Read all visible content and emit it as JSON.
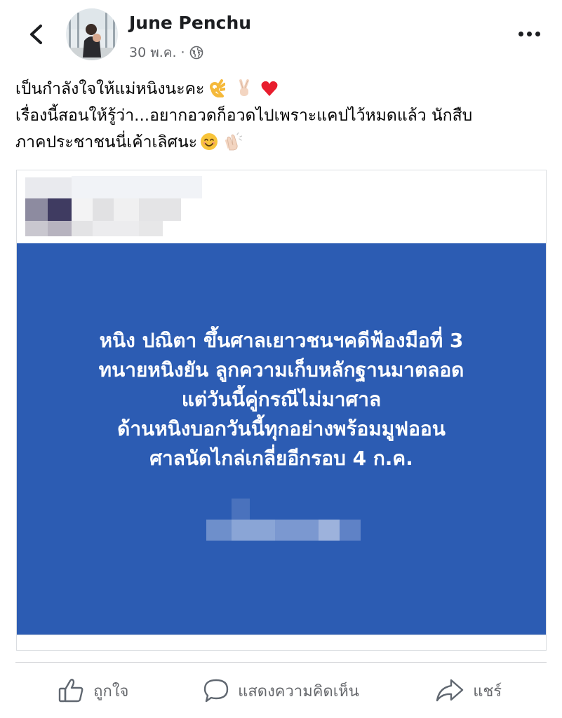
{
  "post": {
    "author": "June Penchu",
    "date": "30 พ.ค.",
    "meta_separator": "·",
    "audience_icon": "globe-icon",
    "text_lines": [
      "เป็นกำลังใจให้แม่หนิงนะคะ",
      "เรื่องนี้สอนให้รู้ว่า...อยากอวดก็อวดไปเพราะแคปไว้หมดแล้ว นักสืบ",
      "ภาคประชาชนนี่เค้าเลิศนะ"
    ],
    "emojis_line1": [
      "ok-hand-emoji",
      "victory-hand-emoji",
      "red-heart-emoji"
    ],
    "emojis_line3": [
      "smiling-face-emoji",
      "clapping-hands-emoji"
    ]
  },
  "shared_card": {
    "background_color": "#2c5cb3",
    "headline_lines": [
      "หนิง ปณิตา ขึ้นศาลเยาวชนฯคดีฟ้องมือที่ 3",
      "ทนายหนิงยัน ลูกความเก็บหลักฐานมาตลอด",
      "แต่วันนี้คู่กรณีไม่มาศาล",
      "ด้านหนิงบอกวันนี้ทุกอย่างพร้อมมูฟออน",
      "ศาลนัดไกล่เกลี่ยอีกรอบ 4 ก.ค."
    ]
  },
  "actions": {
    "like": "ถูกใจ",
    "comment": "แสดงความคิดเห็น",
    "share": "แชร์"
  },
  "colors": {
    "accent_text": "#65676b",
    "card_blue": "#2c5cb3"
  }
}
